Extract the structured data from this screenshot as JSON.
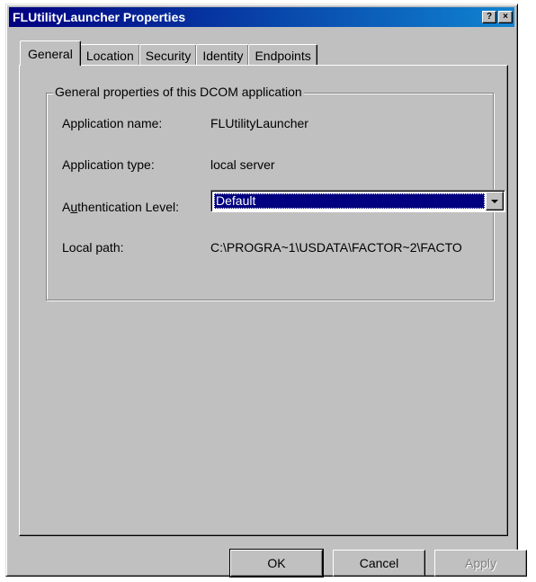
{
  "window": {
    "title": "FLUtilityLauncher Properties",
    "help_icon": "?",
    "close_icon": "×"
  },
  "tabs": [
    {
      "label": "General",
      "active": true
    },
    {
      "label": "Location",
      "active": false
    },
    {
      "label": "Security",
      "active": false
    },
    {
      "label": "Identity",
      "active": false
    },
    {
      "label": "Endpoints",
      "active": false
    }
  ],
  "group": {
    "legend": "General properties of this DCOM application",
    "application_name_label": "Application name:",
    "application_name_value": "FLUtilityLauncher",
    "application_type_label": "Application type:",
    "application_type_value": "local server",
    "auth_label_prefix": "A",
    "auth_label_underlined": "u",
    "auth_label_suffix": "thentication Level:",
    "auth_level_value": "Default",
    "local_path_label": "Local path:",
    "local_path_value": "C:\\PROGRA~1\\USDATA\\FACTOR~2\\FACTO"
  },
  "buttons": {
    "ok": "OK",
    "cancel": "Cancel",
    "apply": "Apply"
  }
}
